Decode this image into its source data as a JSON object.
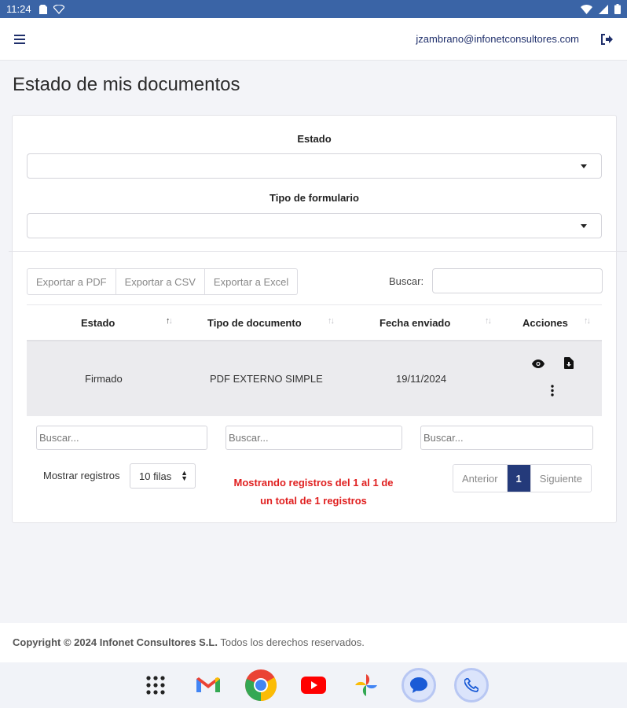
{
  "statusbar": {
    "time": "11:24"
  },
  "header": {
    "user_email": "jzambrano@infonetconsultores.com"
  },
  "page": {
    "title": "Estado de mis documentos"
  },
  "filters": {
    "estado_label": "Estado",
    "estado_value": "",
    "tipo_label": "Tipo de formulario",
    "tipo_value": ""
  },
  "toolbar": {
    "export_pdf": "Exportar a PDF",
    "export_csv": "Exportar a CSV",
    "export_excel": "Exportar a Excel",
    "search_label": "Buscar:",
    "search_value": ""
  },
  "table": {
    "columns": [
      "Estado",
      "Tipo de documento",
      "Fecha enviado",
      "Acciones"
    ],
    "rows": [
      {
        "estado": "Firmado",
        "tipo": "PDF EXTERNO SIMPLE",
        "fecha": "19/11/2024"
      }
    ],
    "column_search_placeholder": "Buscar..."
  },
  "pagination": {
    "show_label": "Mostrar registros",
    "rows_option": "10 filas",
    "info_line1": "Mostrando registros del 1 al 1 de",
    "info_line2": "un total de 1 registros",
    "prev": "Anterior",
    "current": "1",
    "next": "Siguiente"
  },
  "footer": {
    "copyright": "Copyright © 2024 Infonet Consultores S.L.",
    "rights": "Todos los derechos reservados."
  },
  "dock": {
    "apps": [
      "app-drawer-icon",
      "gmail-icon",
      "chrome-icon",
      "youtube-icon",
      "photos-icon",
      "messages-icon",
      "phone-icon"
    ]
  },
  "colors": {
    "statusbar": "#3a64a6",
    "primary": "#243a7a",
    "info_text": "#e02020"
  }
}
